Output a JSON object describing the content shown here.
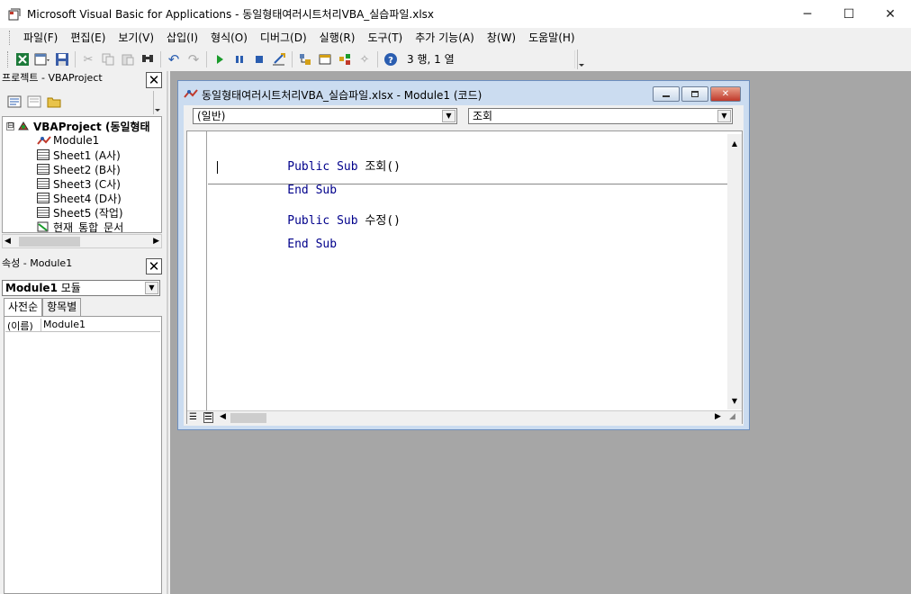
{
  "window": {
    "title": "Microsoft Visual Basic for Applications - 동일형태여러시트처리VBA_실습파일.xlsx",
    "minimize": "─",
    "maximize": "☐",
    "close": "✕"
  },
  "menu": {
    "items": [
      "파일(F)",
      "편집(E)",
      "보기(V)",
      "삽입(I)",
      "형식(O)",
      "디버그(D)",
      "실행(R)",
      "도구(T)",
      "추가 기능(A)",
      "창(W)",
      "도움말(H)"
    ]
  },
  "toolbar": {
    "position": "3 행, 1 열"
  },
  "project": {
    "title": "프로젝트 - VBAProject",
    "close": "✕",
    "root": "VBAProject (동일형태",
    "items": [
      "Module1",
      "Sheet1 (A사)",
      "Sheet2 (B사)",
      "Sheet3 (C사)",
      "Sheet4 (D사)",
      "Sheet5 (작업)",
      "현재_통합_문서"
    ],
    "expander": "⊟"
  },
  "properties": {
    "title": "속성 - Module1",
    "close": "✕",
    "object_name": "Module1",
    "object_type": "모듈",
    "tabs": [
      "사전순",
      "항목별"
    ],
    "rows": [
      {
        "key": "(이름)",
        "value": "Module1"
      }
    ]
  },
  "code_window": {
    "title": "동일형태여러시트처리VBA_실습파일.xlsx - Module1 (코드)",
    "object_combo": "(일반)",
    "proc_combo": "조회",
    "lines": [
      {
        "kw": "Public Sub",
        "rest": " 조회()"
      },
      {
        "kw": "End Sub",
        "rest": ""
      },
      {
        "kw": "Public Sub",
        "rest": " 수정()"
      },
      {
        "kw": "End Sub",
        "rest": ""
      }
    ]
  },
  "colors": {
    "keyword": "#00008b",
    "mdi_background": "#a6a6a6",
    "code_window_frame": "#cbdcf0"
  }
}
